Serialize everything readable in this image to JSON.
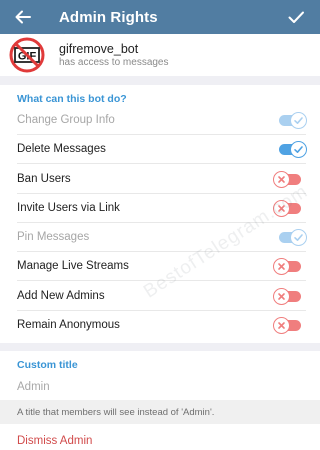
{
  "header": {
    "title": "Admin Rights",
    "background": "#517da2"
  },
  "bot": {
    "name": "gifremove_bot",
    "subtitle": "has access to messages",
    "avatar_text": "GIF"
  },
  "permissions": {
    "header": "What can this bot do?",
    "items": [
      {
        "label": "Change Group Info",
        "state": "on",
        "disabled": true
      },
      {
        "label": "Delete Messages",
        "state": "on",
        "disabled": false
      },
      {
        "label": "Ban Users",
        "state": "off",
        "disabled": false
      },
      {
        "label": "Invite Users via Link",
        "state": "off",
        "disabled": false
      },
      {
        "label": "Pin Messages",
        "state": "on",
        "disabled": true
      },
      {
        "label": "Manage Live Streams",
        "state": "off",
        "disabled": false
      },
      {
        "label": "Add New Admins",
        "state": "off",
        "disabled": false
      },
      {
        "label": "Remain Anonymous",
        "state": "off",
        "disabled": false
      }
    ]
  },
  "custom_title": {
    "label": "Custom title",
    "placeholder": "Admin",
    "hint": "A title that members will see instead of 'Admin'."
  },
  "dismiss_label": "Dismiss Admin",
  "watermark": "BestofTelegram.com",
  "colors": {
    "accent": "#3a95d5",
    "toggle_on": "#4fa2e3",
    "toggle_off": "#f07e7e",
    "danger": "#d14b4b"
  }
}
